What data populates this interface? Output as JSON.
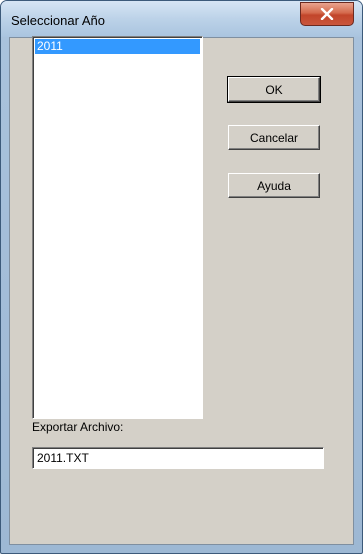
{
  "window": {
    "title": "Seleccionar Año"
  },
  "year_list": {
    "items": [
      {
        "label": "2011",
        "selected": true
      }
    ]
  },
  "buttons": {
    "ok_label": "OK",
    "cancel_label": "Cancelar",
    "help_label": "Ayuda"
  },
  "export": {
    "label": "Exportar Archivo:",
    "value": "2011.TXT"
  },
  "colors": {
    "selection": "#3399ff",
    "dialog_face": "#d4d0c8",
    "close_button": "#c2452a"
  },
  "icons": {
    "close": "close-icon"
  }
}
